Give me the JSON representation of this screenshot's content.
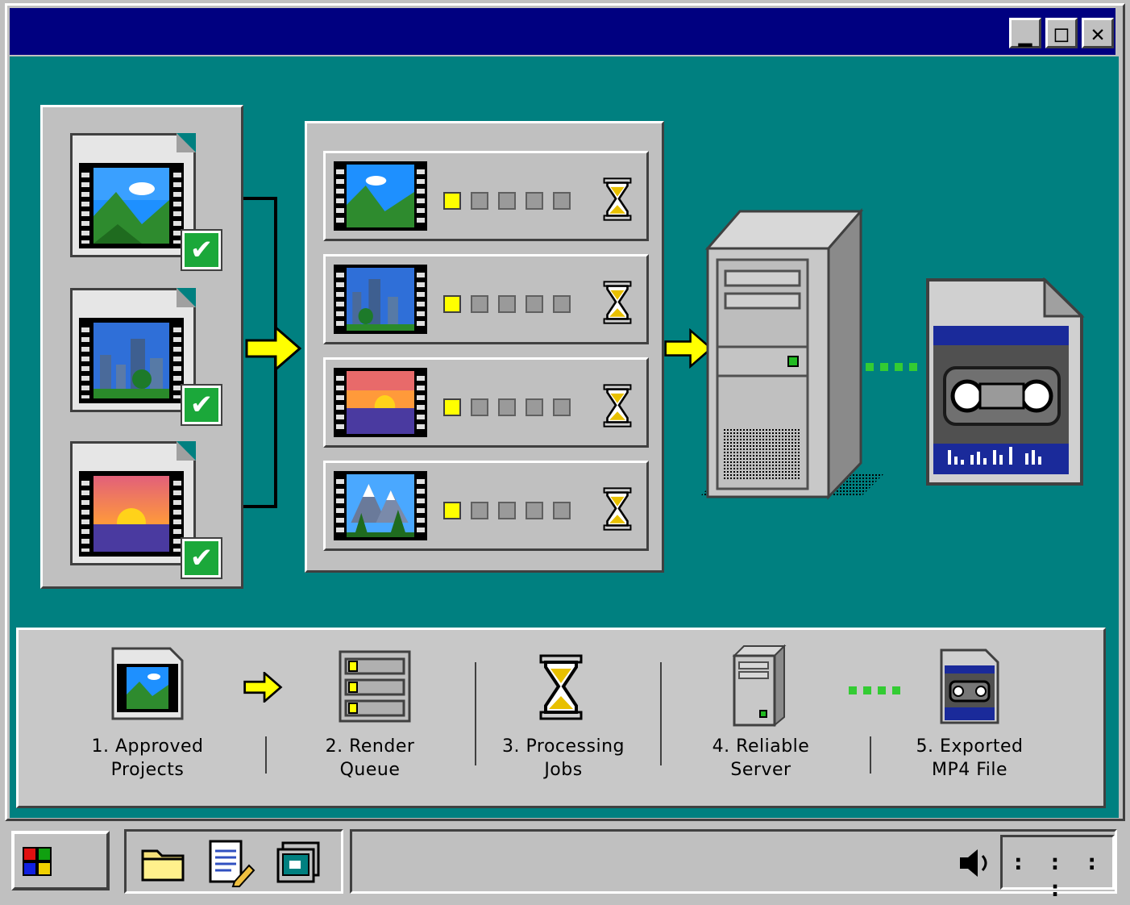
{
  "window": {
    "title": "",
    "buttons": {
      "minimize": "▁",
      "maximize": "□",
      "close": "✕"
    }
  },
  "diagram": {
    "projects": [
      {
        "scene": "mountains",
        "status": "approved"
      },
      {
        "scene": "city",
        "status": "approved"
      },
      {
        "scene": "sunset",
        "status": "approved"
      }
    ],
    "queue": [
      {
        "scene": "mountains",
        "progress_blocks": 1,
        "total_blocks": 5,
        "status": "waiting"
      },
      {
        "scene": "city",
        "progress_blocks": 1,
        "total_blocks": 5,
        "status": "waiting"
      },
      {
        "scene": "sunset",
        "progress_blocks": 1,
        "total_blocks": 5,
        "status": "waiting"
      },
      {
        "scene": "snowy-peaks",
        "progress_blocks": 1,
        "total_blocks": 5,
        "status": "waiting"
      }
    ],
    "server_led": "#22bb22",
    "output_file": "cassette"
  },
  "legend": {
    "steps": [
      {
        "line1": "1. Approved",
        "line2": "Projects"
      },
      {
        "line1": "2. Render",
        "line2": "Queue"
      },
      {
        "line1": "3. Processing",
        "line2": "Jobs"
      },
      {
        "line1": "4. Reliable",
        "line2": "Server"
      },
      {
        "line1": "5. Exported",
        "line2": "MP4 File"
      }
    ]
  },
  "taskbar": {
    "start_icon": "windows-logo-icon",
    "quick_launch": [
      "folder-icon",
      "notepad-icon",
      "monitor-icon"
    ],
    "tray": {
      "volume_icon": "speaker-icon",
      "clock_placeholder": ": : : :"
    }
  },
  "colors": {
    "desktop_teal": "#008080",
    "titlebar_navy": "#000080",
    "accent_yellow": "#ffff00",
    "connector_green": "#33cc33"
  }
}
